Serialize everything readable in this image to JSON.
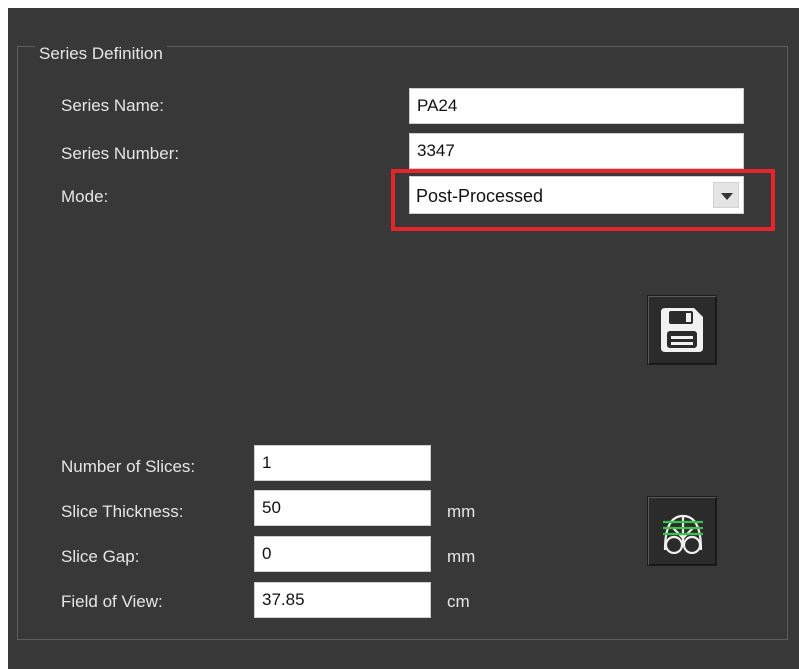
{
  "groupbox": {
    "title": "Series Definition"
  },
  "series_name": {
    "label": "Series Name:",
    "value": "PA24"
  },
  "series_number": {
    "label": "Series Number:",
    "value": "3347"
  },
  "mode": {
    "label": "Mode:",
    "selected": "Post-Processed"
  },
  "save_button": {
    "icon": "floppy-disk-icon"
  },
  "slices": {
    "count_label": "Number of Slices:",
    "count_value": "1",
    "thickness_label": "Slice Thickness:",
    "thickness_value": "50",
    "thickness_unit": "mm",
    "gap_label": "Slice Gap:",
    "gap_value": "0",
    "gap_unit": "mm",
    "fov_label": "Field of View:",
    "fov_value": "37.85",
    "fov_unit": "cm"
  },
  "planning_button": {
    "icon": "slice-planning-icon",
    "accent": "#3bc24a"
  },
  "colors": {
    "highlight": "#e3262b",
    "panel_bg": "#383838"
  }
}
